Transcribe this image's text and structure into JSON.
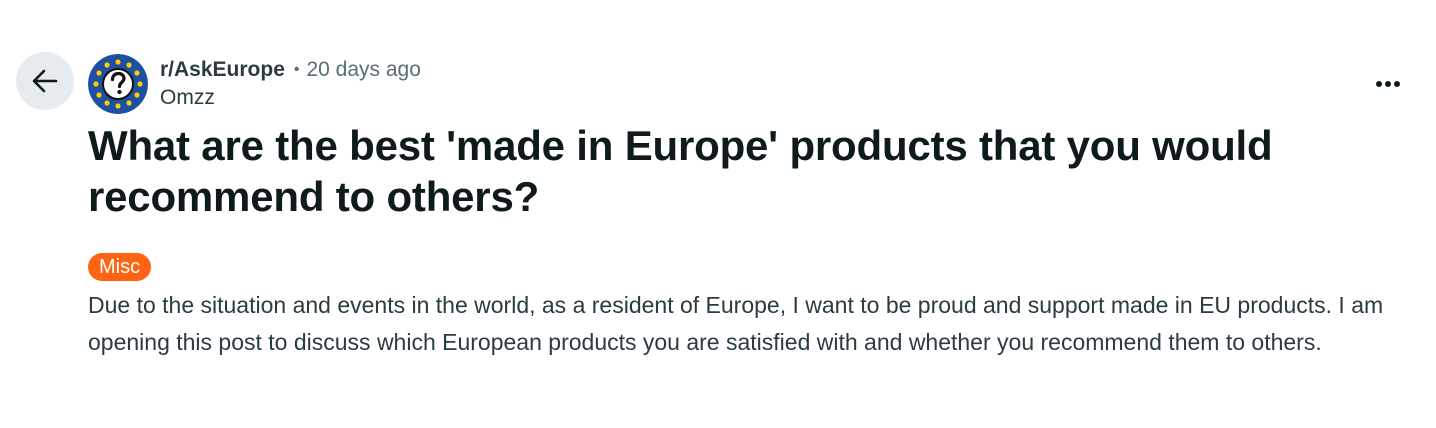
{
  "post": {
    "back_icon": "arrow-left-icon",
    "subreddit_icon": "eu-question-mark-icon",
    "subreddit": "r/AskEurope",
    "separator": "•",
    "time": "20 days ago",
    "author": "Omzz",
    "more_icon": "more-horizontal-icon",
    "title": "What are the best 'made in Europe' products that you would recommend to others?",
    "flair": "Misc",
    "body": "Due to the situation and events in the world, as a resident of Europe, I want to be proud and support made in EU products. I am opening this post to discuss which European products you are satisfied with and whether you recommend them to others."
  },
  "colors": {
    "flair_bg": "#ff6314",
    "back_button_bg": "#e5ebee",
    "eu_blue": "#1d4fa3",
    "eu_star": "#ffcc00"
  }
}
